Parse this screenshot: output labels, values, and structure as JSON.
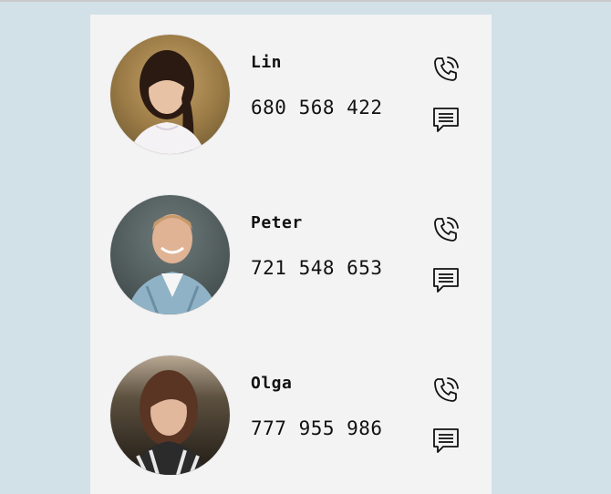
{
  "contacts": [
    {
      "name": "Lin",
      "phone": "680 568 422",
      "avatar_icon": "avatar-photo-icon",
      "actions": [
        "phone-call-icon",
        "message-icon"
      ]
    },
    {
      "name": "Peter",
      "phone": "721 548 653",
      "avatar_icon": "avatar-photo-icon",
      "actions": [
        "phone-call-icon",
        "message-icon"
      ]
    },
    {
      "name": "Olga",
      "phone": "777 955 986",
      "avatar_icon": "avatar-photo-icon",
      "actions": [
        "phone-call-icon",
        "message-icon"
      ]
    }
  ],
  "colors": {
    "page_background": "#d2e1e7",
    "card_background": "#f3f3f3",
    "text": "#111111"
  }
}
